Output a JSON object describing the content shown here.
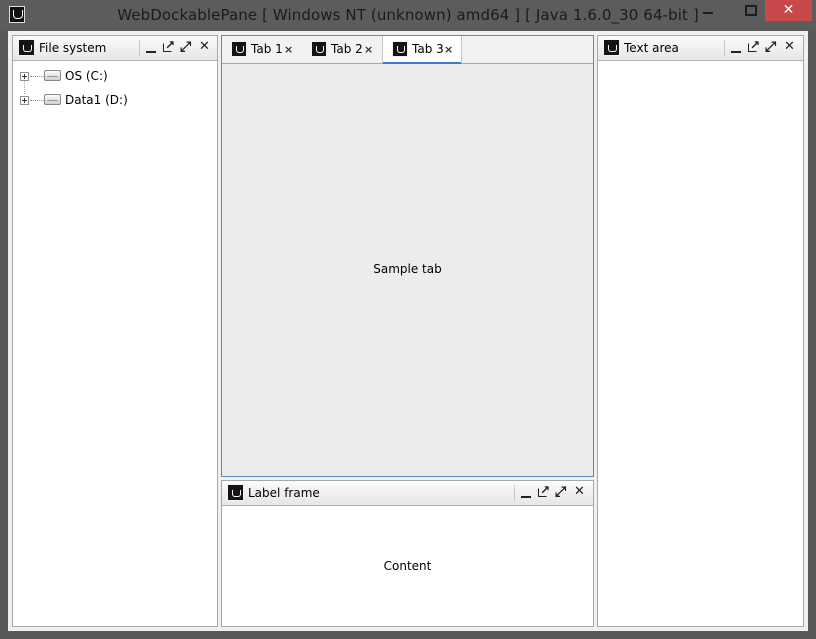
{
  "window": {
    "title": "WebDockablePane [ Windows NT (unknown) amd64 ] [ Java 1.6.0_30 64-bit ]",
    "icon": "java-cup-icon",
    "controls": {
      "close_glyph": "✕"
    }
  },
  "file_system_panel": {
    "title": "File system",
    "tree": [
      {
        "label": "OS (C:)"
      },
      {
        "label": "Data1 (D:)"
      }
    ]
  },
  "tabs_panel": {
    "tabs": [
      {
        "label": "Tab 1",
        "close": "×"
      },
      {
        "label": "Tab 2",
        "close": "×"
      },
      {
        "label": "Tab 3",
        "close": "×"
      }
    ],
    "active_tab": "Tab 3",
    "body_text": "Sample tab",
    "accent_color": "#3d7cc9"
  },
  "label_frame_panel": {
    "title": "Label frame",
    "body_text": "Content"
  },
  "text_area_panel": {
    "title": "Text area",
    "body_text": ""
  }
}
